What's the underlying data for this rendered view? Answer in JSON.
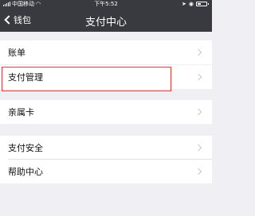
{
  "status_bar": {
    "carrier": "中国移动",
    "time": "下午5:52"
  },
  "nav": {
    "back_label": "钱包",
    "title": "支付中心"
  },
  "list": {
    "items": [
      {
        "label": "账单"
      },
      {
        "label": "支付管理",
        "highlighted": true
      },
      {
        "label": "亲属卡"
      },
      {
        "label": "支付安全"
      },
      {
        "label": "帮助中心"
      }
    ]
  },
  "colors": {
    "nav_background": "#393a3f",
    "page_background": "#efeff4",
    "highlight": "#e03a3a"
  }
}
